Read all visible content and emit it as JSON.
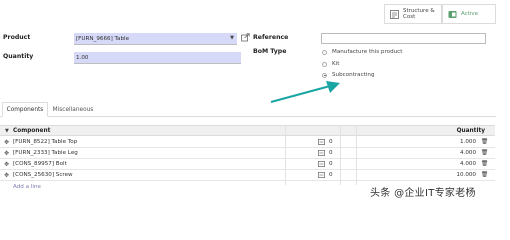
{
  "stat_buttons": {
    "structure_cost_label": "Structure &\nCost",
    "active_label": "Active"
  },
  "colors": {
    "accent": "#7c7bad",
    "highlight": "#d6d9f7",
    "arrow": "#1aa5a5",
    "active_green": "#5b9e6e"
  },
  "form": {
    "product_label": "Product",
    "product_value": "[FURN_9666] Table",
    "quantity_label": "Quantity",
    "quantity_value": "1.00",
    "reference_label": "Reference",
    "reference_value": "",
    "bom_type_label": "BoM Type",
    "bom_type_options": [
      "Manufacture this product",
      "Kit",
      "Subcontracting"
    ],
    "bom_type_selected": "Subcontracting"
  },
  "tabs": [
    "Components",
    "Miscellaneous"
  ],
  "table": {
    "header_component": "Component",
    "header_quantity": "Quantity",
    "rows": [
      {
        "component": "[FURN_8522] Table Top",
        "forecast": "0",
        "quantity": "1.000"
      },
      {
        "component": "[FURN_2333] Table Leg",
        "forecast": "0",
        "quantity": "4.000"
      },
      {
        "component": "[CONS_89957] Bolt",
        "forecast": "0",
        "quantity": "4.000"
      },
      {
        "component": "[CONS_25630] Screw",
        "forecast": "0",
        "quantity": "10.000"
      }
    ],
    "add_line": "Add a line"
  },
  "watermark": "头条 @企业IT专家老杨"
}
